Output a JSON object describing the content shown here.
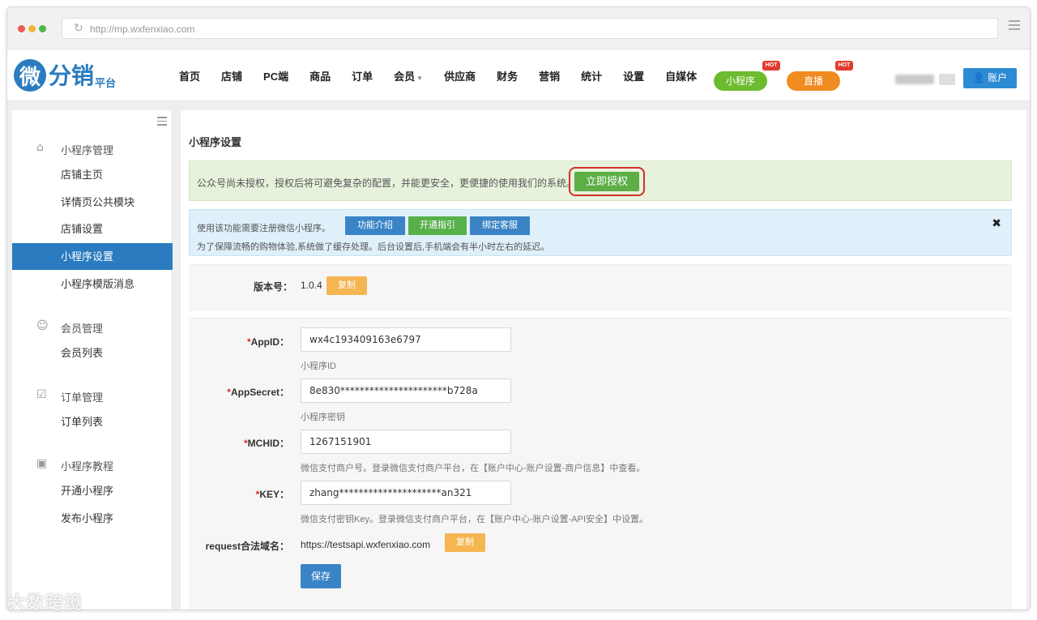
{
  "browser": {
    "url": "http://mp.wxfenxiao.com"
  },
  "logo": {
    "glyph": "微",
    "main": "分销",
    "sub": "平台"
  },
  "nav": {
    "items": [
      "首页",
      "店铺",
      "PC端",
      "商品",
      "订单",
      "会员",
      "供应商",
      "财务",
      "营销",
      "统计",
      "设置",
      "自媒体"
    ],
    "dropdown_item_index": 5,
    "miniprogram_pill": "小程序",
    "live_pill": "直播",
    "hot_badge": "HOT",
    "account_label": "账户"
  },
  "sidebar": {
    "groups": [
      {
        "label": "小程序管理",
        "icon": "home-icon",
        "items": [
          "店铺主页",
          "详情页公共模块",
          "店铺设置",
          "小程序设置",
          "小程序模版消息"
        ]
      },
      {
        "label": "会员管理",
        "icon": "member-icon",
        "items": [
          "会员列表"
        ]
      },
      {
        "label": "订单管理",
        "icon": "order-icon",
        "items": [
          "订单列表"
        ]
      },
      {
        "label": "小程序教程",
        "icon": "tutorial-icon",
        "items": [
          "开通小程序",
          "发布小程序"
        ]
      }
    ],
    "active_item": "小程序设置"
  },
  "page": {
    "title": "小程序设置",
    "auth_alert": {
      "text": "公众号尚未授权，授权后将可避免复杂的配置，并能更安全，更便捷的使用我们的系统。",
      "button": "立即授权"
    },
    "info_alert": {
      "line1": "使用该功能需要注册微信小程序。",
      "buttons": [
        "功能介绍",
        "开通指引",
        "绑定客服"
      ],
      "line2": "为了保障流畅的购物体验,系统做了缓存处理。后台设置后,手机端会有半小时左右的延迟。"
    },
    "version": {
      "label": "版本号：",
      "value": "1.0.4",
      "copy": "复制"
    },
    "form": {
      "appid": {
        "label": "AppID：",
        "value": "wx4c193409163e6797",
        "help": "小程序ID"
      },
      "appsecret": {
        "label": "AppSecret：",
        "value": "8e830**********************b728a",
        "help": "小程序密钥"
      },
      "mchid": {
        "label": "MCHID：",
        "value": "1267151901",
        "help": "微信支付商户号。登录微信支付商户平台，在【账户中心-账户设置-商户信息】中查看。"
      },
      "key": {
        "label": "KEY：",
        "value": "zhang*********************an321",
        "help": "微信支付密钥Key。登录微信支付商户平台，在【账户中心-账户设置-API安全】中设置。"
      },
      "domain": {
        "label": "request合法域名：",
        "value": "https://testsapi.wxfenxiao.com",
        "copy": "复制"
      },
      "required_mark": "*",
      "save": "保存"
    }
  },
  "watermark": "大数跨境",
  "colors": {
    "brand_blue": "#2b7bc0",
    "success_green": "#5cae45",
    "warning_orange": "#f5b551",
    "highlight_red": "#d2302a"
  }
}
